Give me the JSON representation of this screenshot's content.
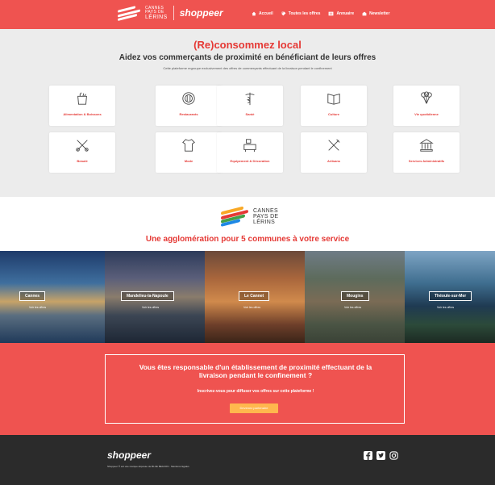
{
  "header": {
    "brand_line1": "CANNES",
    "brand_line2": "PAYS DE",
    "brand_line3": "LÉRINS",
    "brand_shop": "shoppeer",
    "nav": [
      {
        "label": "Accueil",
        "icon": "home-icon"
      },
      {
        "label": "Toutes les offres",
        "icon": "tag-icon"
      },
      {
        "label": "Annuaire",
        "icon": "directory-icon"
      },
      {
        "label": "Newsletter",
        "icon": "envelope-icon"
      }
    ]
  },
  "hero": {
    "title": "(Re)consommez local",
    "subtitle": "Aidez vos commerçants de proximité en bénéficiant de leurs offres",
    "description": "Cette plateforme regroupe exclusivement des offres de commerçants effectuant de la livraison pendant le confinement"
  },
  "categories": [
    {
      "label": "Alimentation & Boissons",
      "icon": "grocery-bag-icon"
    },
    {
      "label": "Restaurants",
      "icon": "plate-cutlery-icon"
    },
    {
      "label": "Santé",
      "icon": "caduceus-icon"
    },
    {
      "label": "Culture",
      "icon": "book-icon"
    },
    {
      "label": "Vie quotidienne",
      "icon": "balloons-icon"
    },
    {
      "label": "Beauté",
      "icon": "scissors-comb-icon"
    },
    {
      "label": "Mode",
      "icon": "tshirt-icon"
    },
    {
      "label": "Equipement & Décoration",
      "icon": "furniture-icon"
    },
    {
      "label": "Artisans",
      "icon": "tools-icon"
    },
    {
      "label": "Services Administratifs",
      "icon": "government-building-icon"
    }
  ],
  "agglo": {
    "logo_line1": "CANNES",
    "logo_line2": "PAYS DE",
    "logo_line3": "LÉRINS",
    "title": "Une agglomération pour 5 communes à votre service"
  },
  "towns": [
    {
      "name": "Cannes",
      "link": "Voir les offres"
    },
    {
      "name": "Mandelieu-la-Napoule",
      "link": "Voir les offres"
    },
    {
      "name": "Le Cannet",
      "link": "Voir les offres"
    },
    {
      "name": "Mougins",
      "link": "Voir les offres"
    },
    {
      "name": "Théoule-sur-Mer",
      "link": "Voir les offres"
    }
  ],
  "cta": {
    "title_line1": "Vous êtes responsable d'un établissement de proximité effectuant de la",
    "title_line2": "livraison pendant le confinement ?",
    "subtitle": "Inscrivez-vous pour diffuser vos offres sur cette plateforme !",
    "button": "Devenez partenaire"
  },
  "footer": {
    "logo": "shoppeer",
    "note": "Shoppeer ® est une marque déposée de BLUE BEACON · Mentions légales",
    "socials": [
      "facebook-icon",
      "twitter-icon",
      "instagram-icon"
    ]
  },
  "colors": {
    "brand_red": "#ef5350",
    "title_red": "#e53935",
    "cta_button": "#ffb74d",
    "footer": "#2b2b2b"
  }
}
